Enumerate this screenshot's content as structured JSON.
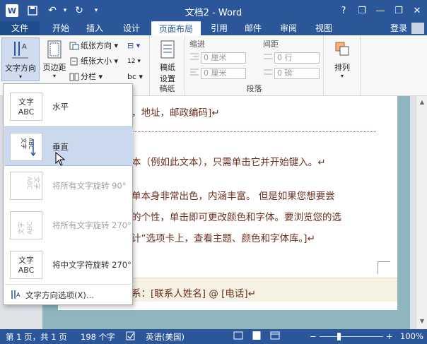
{
  "title_bar": {
    "title": "文档2 - Word",
    "help": "?",
    "minimize": "—",
    "restore": "❐",
    "close": "✕",
    "word_logo": "W",
    "save_icon": "save-icon",
    "undo_glyph": "↶",
    "redo_glyph": "↻",
    "qat_more": "▾"
  },
  "tabs": [
    {
      "label": "文件"
    },
    {
      "label": "开始"
    },
    {
      "label": "插入"
    },
    {
      "label": "设计"
    },
    {
      "label": "页面布局"
    },
    {
      "label": "引用"
    },
    {
      "label": "邮件"
    },
    {
      "label": "审阅"
    },
    {
      "label": "视图"
    }
  ],
  "active_tab": "页面布局",
  "login": "登录",
  "ribbon": {
    "text_direction": "文字方向",
    "margins": "页边距",
    "orientation": "纸张方向",
    "size": "纸张大小",
    "columns": "分栏",
    "breaks_glyph": "⊟",
    "line_numbers_glyph": "12",
    "hyphenation_glyph": "bc",
    "manuscript_line1": "稿纸",
    "manuscript_line2": "设置",
    "manuscript_group": "稿纸",
    "indent_header": "缩进",
    "spacing_header": "间距",
    "indent_left": "0 厘米",
    "indent_right": "0 厘米",
    "spacing_before": "0 行",
    "spacing_after": "0 磅",
    "paragraph_group": "段落",
    "arrange": "排列",
    "arrange_arrow": "▾",
    "dropdown_arrow": "▾"
  },
  "document": {
    "line1": "，地址，邮政编码]↵",
    "line2": "本（例如此文本），只需单击它并开始键入。↵",
    "line3": "单本身非常出色，内涵丰富。 但是如果您想要尝",
    "line4": "的个性，单击即可更改颜色和字体。要浏览您的选",
    "line5": "计”选项卡上，查看主题、颜色和字体库。]↵",
    "footer_line": "系：[联系人姓名] @ [电话]↵"
  },
  "dropdown": {
    "items": [
      {
        "label": "水平",
        "thumb": "文字ABC"
      },
      {
        "label": "垂直",
        "thumb": "ABC文字"
      },
      {
        "label": "将所有文字旋转 90°",
        "thumb": "ABC文字"
      },
      {
        "label": "将所有文字旋转 270°",
        "thumb": "文字ABC"
      },
      {
        "label": "将中文字符旋转 270°",
        "thumb": "文字ABC"
      }
    ],
    "thumb_text": {
      "top": "文字",
      "bottom": "ABC"
    },
    "options": "文字方向选项(X)..."
  },
  "status_bar": {
    "page": "第 1 页，共 1 页",
    "words": "198 个字",
    "language": "英语(美国)",
    "zoom_minus": "−",
    "zoom_plus": "+",
    "zoom": "100%"
  },
  "zoom_level": 100,
  "colors": {
    "title_bar": "#2b579a",
    "document_text": "#6b2f1e",
    "selected_item": "#cbd9ef"
  }
}
